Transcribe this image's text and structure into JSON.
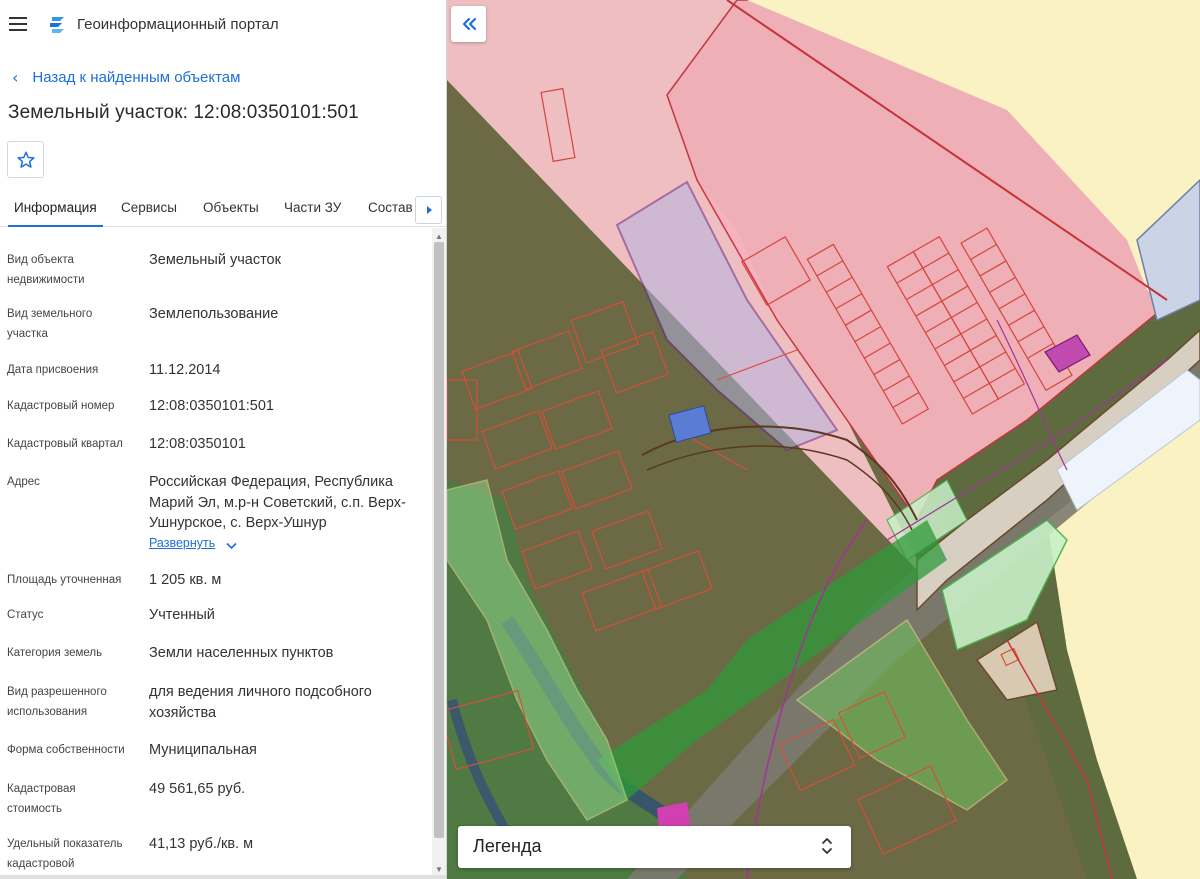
{
  "app": {
    "title": "Геоинформационный портал"
  },
  "nav": {
    "back_label": "Назад к найденным объектам"
  },
  "page": {
    "title": "Земельный участок: 12:08:0350101:501"
  },
  "tabs": [
    {
      "label": "Информация",
      "active": true
    },
    {
      "label": "Сервисы",
      "active": false
    },
    {
      "label": "Объекты",
      "active": false
    },
    {
      "label": "Части ЗУ",
      "active": false
    },
    {
      "label": "Состав",
      "active": false
    }
  ],
  "details": {
    "object_type": {
      "label": "Вид объекта недвижимости",
      "value": "Земельный участок"
    },
    "parcel_type": {
      "label": "Вид земельного участка",
      "value": "Землепользование"
    },
    "assigned_date": {
      "label": "Дата присвоения",
      "value": "11.12.2014"
    },
    "cadastral_number": {
      "label": "Кадастровый номер",
      "value": "12:08:0350101:501"
    },
    "cadastral_quarter": {
      "label": "Кадастровый квартал",
      "value": "12:08:0350101"
    },
    "address": {
      "label": "Адрес",
      "value": "Российская Федерация, Республика Марий Эл, м.р-н Советский, с.п. Верх-Ушнурское, с. Верх-Ушнур",
      "expand_label": "Развернуть"
    },
    "area": {
      "label": "Площадь уточненная",
      "value": "1 205 кв. м"
    },
    "status": {
      "label": "Статус",
      "value": "Учтенный"
    },
    "land_category": {
      "label": "Категория земель",
      "value": "Земли населенных пунктов"
    },
    "permitted_use": {
      "label": "Вид разрешенного использования",
      "value": "для ведения личного подсобного хозяйства"
    },
    "ownership": {
      "label": "Форма собственности",
      "value": "Муниципальная"
    },
    "cadastral_value": {
      "label": "Кадастровая стоимость",
      "value": "49 561,65 руб."
    },
    "unit_value": {
      "label": "Удельный показатель кадастровой",
      "value": "41,13 руб./кв. м"
    }
  },
  "map": {
    "legend_label": "Легенда"
  },
  "colors": {
    "accent": "#1e6fd9",
    "parcel_pink": "#f4b6bd",
    "zone_yellow": "#fbf2c4",
    "zone_green": "#c9f0c8",
    "selected_parcel": "#7a3fa0"
  },
  "icons": {
    "menu": "hamburger-icon",
    "logo": "portal-logo-icon",
    "back": "chevron-left-icon",
    "favorite": "star-outline-icon",
    "tabs_next": "caret-right-icon",
    "expand": "chevron-down-icon",
    "collapse_panel": "double-chevron-left-icon",
    "legend_toggle": "unfold-icon"
  }
}
